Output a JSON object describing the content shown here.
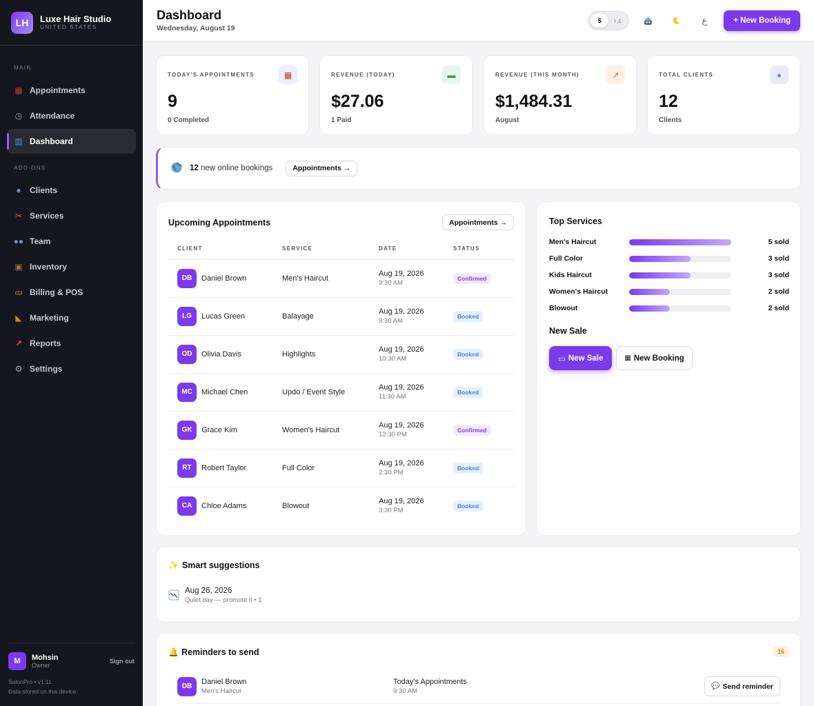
{
  "brand": {
    "initials": "LH",
    "name": "Luxe Hair Studio",
    "region": "UNITED STATES"
  },
  "nav": {
    "main_label": "MAIN",
    "main_items": [
      {
        "label": "Appointments",
        "icon": "calendar-icon"
      },
      {
        "label": "Attendance",
        "icon": "stopwatch-icon"
      },
      {
        "label": "Dashboard",
        "icon": "bar-chart-icon",
        "active": true
      }
    ],
    "addons_label": "ADD-ONS",
    "addon_items": [
      {
        "label": "Clients",
        "icon": "person-icon"
      },
      {
        "label": "Services",
        "icon": "scissors-icon"
      },
      {
        "label": "Team",
        "icon": "people-icon"
      },
      {
        "label": "Inventory",
        "icon": "box-icon"
      },
      {
        "label": "Billing & POS",
        "icon": "credit-card-icon"
      },
      {
        "label": "Marketing",
        "icon": "megaphone-icon"
      },
      {
        "label": "Reports",
        "icon": "chart-icon"
      },
      {
        "label": "Settings",
        "icon": "gear-icon"
      }
    ]
  },
  "user": {
    "initial": "M",
    "name": "Mohsin",
    "role": "Owner",
    "sign_out": "Sign out",
    "version": "SalonPro • v1.11",
    "storage": "Data stored on this device"
  },
  "header": {
    "title": "Dashboard",
    "date": "Wednesday, August 19",
    "currency_options": [
      "$",
      "١,٤"
    ],
    "new_booking": "+ New Booking"
  },
  "stats": [
    {
      "label": "TODAY'S APPOINTMENTS",
      "value": "9",
      "sub": "0 Completed",
      "icon": "calendar-icon",
      "bg": "#f0ebfb"
    },
    {
      "label": "REVENUE (TODAY)",
      "value": "$27.06",
      "sub": "1 Paid",
      "icon": "money-icon",
      "bg": "#e6f6ee"
    },
    {
      "label": "REVENUE (THIS MONTH)",
      "value": "$1,484.31",
      "sub": "August",
      "icon": "chart-up-icon",
      "bg": "#fdf1e0"
    },
    {
      "label": "TOTAL CLIENTS",
      "value": "12",
      "sub": "Clients",
      "icon": "person-icon",
      "bg": "#eceaf7"
    }
  ],
  "banner": {
    "count": "12",
    "text": "new online bookings",
    "button": "Appointments →"
  },
  "upcoming": {
    "title": "Upcoming Appointments",
    "button": "Appointments →",
    "columns": [
      "CLIENT",
      "SERVICE",
      "DATE",
      "STATUS"
    ],
    "rows": [
      {
        "initials": "DB",
        "client": "Daniel Brown",
        "service": "Men's Haircut",
        "date": "Aug 19, 2026",
        "time": "9:30 AM",
        "status": "Confirmed"
      },
      {
        "initials": "LG",
        "client": "Lucas Green",
        "service": "Balayage",
        "date": "Aug 19, 2026",
        "time": "9:30 AM",
        "status": "Booked"
      },
      {
        "initials": "OD",
        "client": "Olivia Davis",
        "service": "Highlights",
        "date": "Aug 19, 2026",
        "time": "10:30 AM",
        "status": "Booked"
      },
      {
        "initials": "MC",
        "client": "Michael Chen",
        "service": "Updo / Event Style",
        "date": "Aug 19, 2026",
        "time": "11:30 AM",
        "status": "Booked"
      },
      {
        "initials": "GK",
        "client": "Grace Kim",
        "service": "Women's Haircut",
        "date": "Aug 19, 2026",
        "time": "12:30 PM",
        "status": "Confirmed"
      },
      {
        "initials": "RT",
        "client": "Robert Taylor",
        "service": "Full Color",
        "date": "Aug 19, 2026",
        "time": "2:30 PM",
        "status": "Booked"
      },
      {
        "initials": "CA",
        "client": "Chloe Adams",
        "service": "Blowout",
        "date": "Aug 19, 2026",
        "time": "3:30 PM",
        "status": "Booked"
      }
    ]
  },
  "top_services": {
    "title": "Top Services",
    "max": 5,
    "items": [
      {
        "name": "Men's Haircut",
        "count": 5,
        "label": "5 sold"
      },
      {
        "name": "Full Color",
        "count": 3,
        "label": "3 sold"
      },
      {
        "name": "Kids Haircut",
        "count": 3,
        "label": "3 sold"
      },
      {
        "name": "Women's Haircut",
        "count": 2,
        "label": "2 sold"
      },
      {
        "name": "Blowout",
        "count": 2,
        "label": "2 sold"
      }
    ]
  },
  "new_sale": {
    "title": "New Sale",
    "sale_button": "New Sale",
    "booking_button": "New Booking"
  },
  "suggestions": {
    "title": "Smart suggestions",
    "items": [
      {
        "date": "Aug 26, 2026",
        "note": "Quiet day — promote it • 1"
      }
    ]
  },
  "reminders": {
    "title": "Reminders to send",
    "count": "16",
    "items": [
      {
        "initials": "DB",
        "client": "Daniel Brown",
        "service": "Men's Haircut",
        "when": "Today's Appointments",
        "time": "9:30 AM",
        "button": "Send reminder"
      }
    ]
  },
  "colors": {
    "accent": "#7c3aed",
    "sidebar": "#16161e",
    "confirmed": "#7c3aed",
    "booked": "#3b82f6"
  }
}
